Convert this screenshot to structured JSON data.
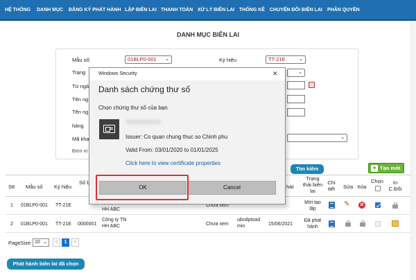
{
  "nav": {
    "items": [
      "HỆ THỐNG",
      "DANH MỤC",
      "ĐĂNG KÝ PHÁT HÀNH",
      "LẬP BIÊN LAI",
      "THANH TOÁN",
      "XỬ LÝ BIÊN LAI",
      "THỐNG KÊ",
      "CHUYỂN ĐỔI BIÊN LAI",
      "PHÂN QUYỀN"
    ]
  },
  "page": {
    "title": "DANH MỤC BIÊN LAI"
  },
  "filters": {
    "mau_so_label": "Mẫu số:",
    "mau_so_value": "01BLP0-001",
    "ky_hieu_label": "Ký hiệu",
    "ky_hieu_value": "TT-21E",
    "trang_label": "Trạng",
    "tu_ngay_label": "Từ ngà",
    "ten_ng1_label": "Tên ng",
    "ten_ng2_label": "Tên ng",
    "hang_label": "hàng",
    "ma_kh_label": "Mã kha",
    "don_vi_label": "Đơn vị",
    "chevron_icon": "chevron-down-icon",
    "calendar_icon": "calendar-icon"
  },
  "actions": {
    "search_label": "Tìm kiếm",
    "add_label": "Tạo mới",
    "publish_label": "Phát hành biên lai đã chọn"
  },
  "table": {
    "headers": {
      "stt": "Stt",
      "mau_so": "Mẫu số",
      "ky_hieu": "Ký hiệu",
      "so_b": "Số b",
      "hat": "hát",
      "trang_thai_1": "Trạng",
      "trang_thai_2": "thái biên",
      "trang_thai_3": "lai",
      "chi_tiet_1": "Chi",
      "chi_tiet_2": "tiết",
      "sua": "Sửa",
      "xoa": "Xóa",
      "chon": "Chọn",
      "in_1": "In",
      "in_2": "C.Đổi"
    },
    "rows": [
      {
        "stt": "1",
        "mau_so": "01BLP0-001",
        "ky_hieu": "TT-21E",
        "so": "",
        "khach_hang_1": "HH ABC",
        "khach_hang_2": "",
        "xem": "Chưa xem",
        "nguoi_lap_1": "",
        "nguoi_lap_2": "",
        "ngay": "",
        "trang_thai_1": "Mới tạo",
        "trang_thai_2": "lập",
        "chon_checked": true
      },
      {
        "stt": "2",
        "mau_so": "01BLP0-001",
        "ky_hieu": "TT-21E",
        "so": "0000001",
        "khach_hang_1": "Công ty TN",
        "khach_hang_2": "HH ABC",
        "xem": "Chưa xem",
        "nguoi_lap_1": "ubndptoad",
        "nguoi_lap_2": "min",
        "ngay": "15/06/2021",
        "trang_thai_1": "Đã phát",
        "trang_thai_2": "hành",
        "chon_checked": false
      }
    ]
  },
  "pager": {
    "page_size_label": "PageSize",
    "page_size_value": "10",
    "prev": "<",
    "current": "1",
    "next": ">"
  },
  "dialog": {
    "window_title": "Windows Security",
    "close_glyph": "✕",
    "heading": "Danh sách chứng thư số",
    "subtitle": "Chọn chứng thư số của bạn",
    "issuer": "Issuer: Co quan chung thuc so Chinh phu",
    "valid": "Valid From: 03/01/2020 to 01/01/2025",
    "link": "Click here to view certificate properties",
    "ok_label": "OK",
    "cancel_label": "Cancel",
    "cert_icon": "certificate-icon"
  },
  "colors": {
    "nav_bg": "#1f6fb2",
    "accent_button": "#1d86b5",
    "add_button": "#6cb33a",
    "highlight": "#e03030",
    "link": "#0f5ba8"
  }
}
